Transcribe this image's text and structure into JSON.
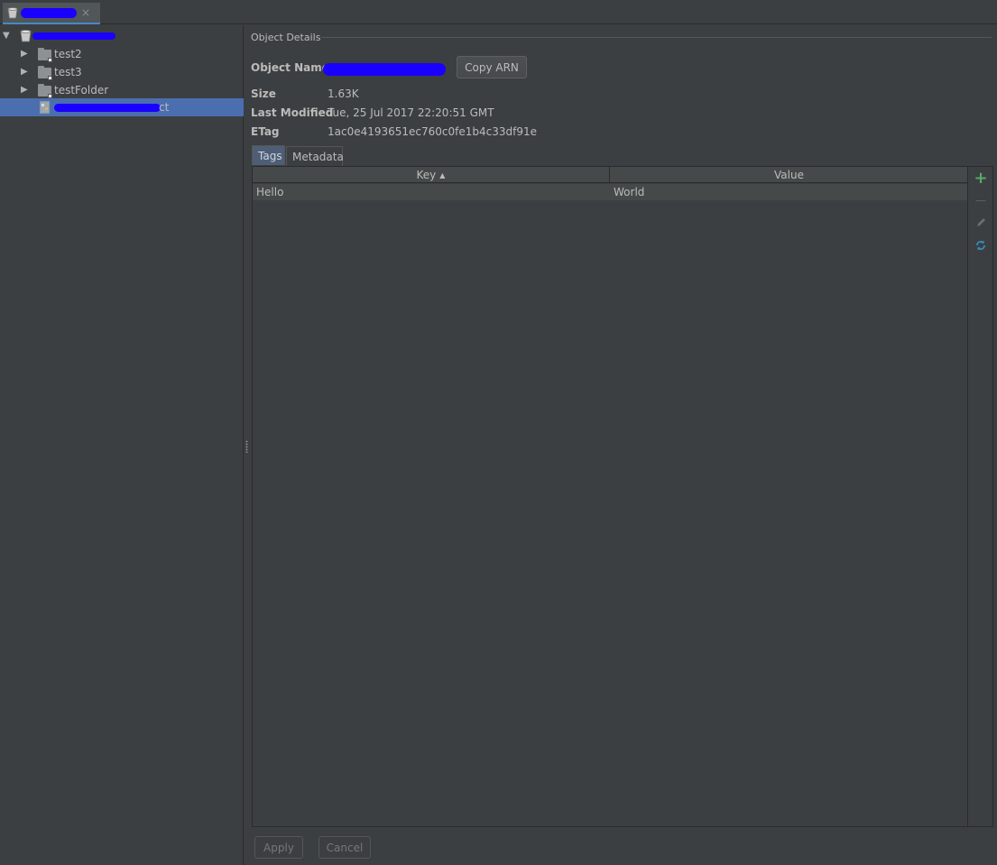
{
  "tabstrip": {
    "tab_icon": "bucket-icon",
    "close_glyph": "×",
    "accent": "#4a88c7",
    "redaction_color": "#1a00ff"
  },
  "tree": {
    "items": [
      {
        "label": "test2",
        "icon": "folder-icon"
      },
      {
        "label": "test3",
        "icon": "folder-icon"
      },
      {
        "label": "testFolder",
        "icon": "folder-icon"
      }
    ],
    "selected_suffix": "ct",
    "selected_color": "#4b6eaf"
  },
  "details": {
    "section_title": "Object Details",
    "object_name_label": "Object  Name",
    "copy_arn_label": "Copy ARN",
    "size_label": "Size",
    "size_value": "1.63K",
    "last_modified_label": "Last Modified",
    "last_modified_value": "Tue, 25 Jul 2017 22:20:51 GMT",
    "etag_label": "ETag",
    "etag_value": "1ac0e4193651ec760c0fe1b4c33df91e"
  },
  "tabs": [
    {
      "label": "Tags",
      "active": true
    },
    {
      "label": "Metadata",
      "active": false
    }
  ],
  "table": {
    "columns": [
      "Key",
      "Value"
    ],
    "sort_indicator": "▲",
    "rows": [
      {
        "key": "Hello",
        "value": "World"
      }
    ]
  },
  "side_toolbar": {
    "add_glyph": "+",
    "remove_glyph": "—",
    "add_color": "#59a869",
    "refresh_color": "#3592c4"
  },
  "footer": {
    "apply_label": "Apply",
    "cancel_label": "Cancel"
  }
}
